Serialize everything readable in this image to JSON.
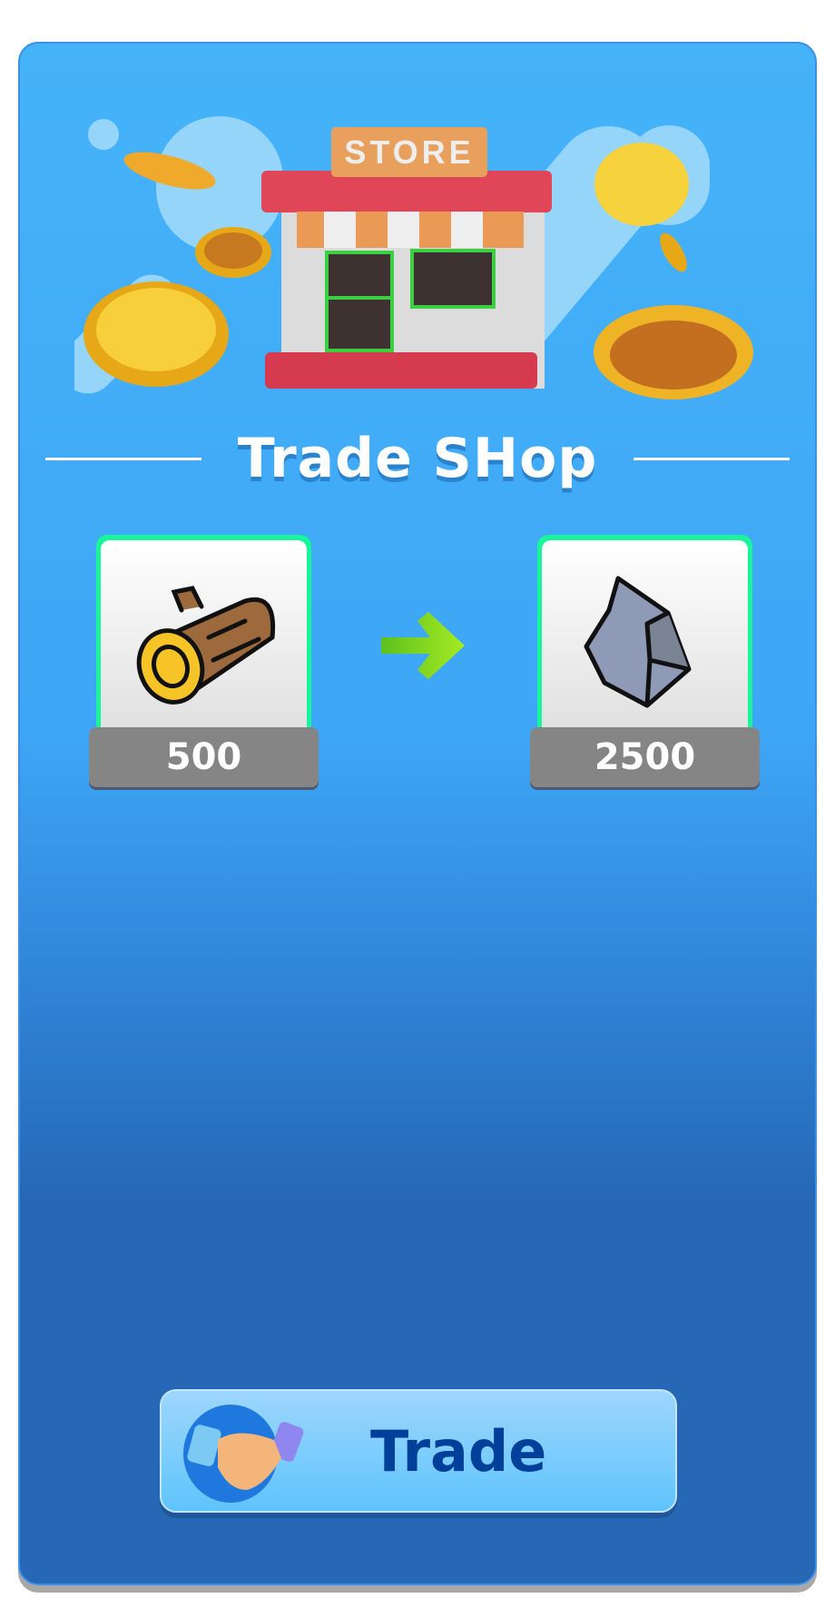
{
  "header": {
    "store_sign": "STORE",
    "title": "Trade SHop"
  },
  "trade": {
    "give": {
      "item": "wood-log",
      "amount": "500"
    },
    "get": {
      "item": "stone",
      "amount": "2500"
    }
  },
  "button": {
    "label": "Trade",
    "icon": "handshake-icon"
  },
  "colors": {
    "accent": "#18f59a",
    "button_text": "#00409a",
    "panel_top": "#45b3f8",
    "panel_bottom": "#2668b5"
  }
}
